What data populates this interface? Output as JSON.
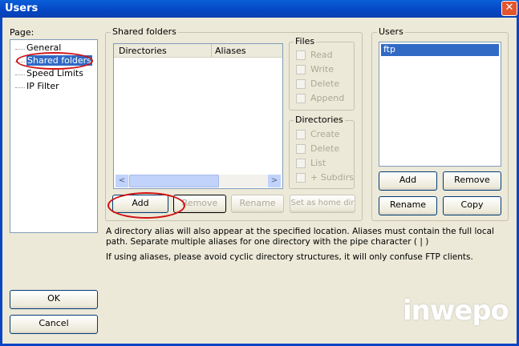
{
  "window": {
    "title": "Users",
    "close": "✕"
  },
  "page_label": "Page:",
  "pages": [
    "General",
    "Shared folders",
    "Speed Limits",
    "IP Filter"
  ],
  "shared": {
    "title": "Shared folders",
    "columns": [
      "Directories",
      "Aliases"
    ],
    "buttons": {
      "add": "Add",
      "remove": "Remove",
      "rename": "Rename",
      "home": "Set as home dir"
    }
  },
  "files": {
    "title": "Files",
    "items": [
      "Read",
      "Write",
      "Delete",
      "Append"
    ]
  },
  "dirs": {
    "title": "Directories",
    "items": [
      "Create",
      "Delete",
      "List",
      "+ Subdirs"
    ]
  },
  "users": {
    "title": "Users",
    "list": [
      "ftp"
    ],
    "buttons": {
      "add": "Add",
      "remove": "Remove",
      "rename": "Rename",
      "copy": "Copy"
    }
  },
  "info": {
    "line1": "A directory alias will also appear at the specified location. Aliases must contain the full local",
    "line2": "path. Separate multiple aliases for one directory with the pipe character ( | )",
    "line3": "If using aliases, please avoid cyclic directory structures, it will only confuse FTP clients."
  },
  "ok": "OK",
  "cancel": "Cancel",
  "watermark": "inwepo"
}
